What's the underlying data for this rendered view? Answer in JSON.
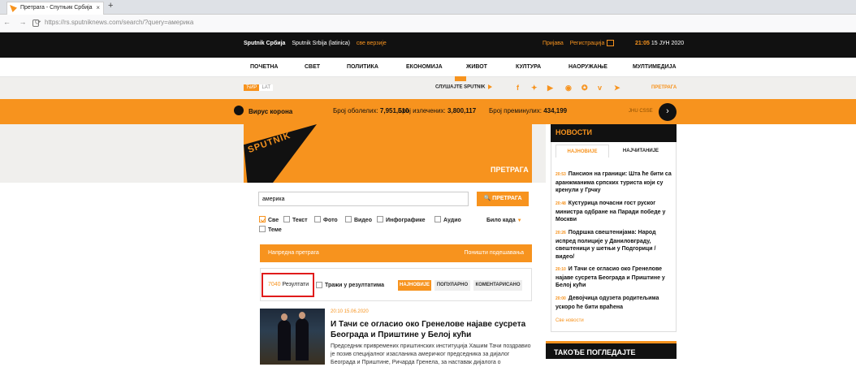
{
  "browser": {
    "tab_title": "Претрага - Спутњик Србија",
    "tab_close": "×",
    "new_tab": "+",
    "nav_buttons": "← → ⟳",
    "url": "https://rs.sputniknews.com/search/?query=америка"
  },
  "topbar": {
    "edition_main": "Sputnik Србија",
    "edition_latin": "Sputnik Srbija (latinica)",
    "all_versions": "све верзије",
    "login": "Пријава",
    "register": "Регистрација",
    "time": "21:05",
    "date": "15 ЈУН 2020"
  },
  "menu": [
    "ПОЧЕТНА",
    "СВЕТ",
    "ПОЛИТИКА",
    "ЕКОНОМИЈА",
    "ЖИВОТ",
    "КУЛТУРА",
    "НАОРУЖАЊЕ",
    "МУЛТИМЕДИЈА"
  ],
  "subbar": {
    "lang_cyr": "ЋИР",
    "lang_lat": "LAT",
    "listen": "СЛУШАЈТЕ SPUTNIK",
    "social_icons": [
      "facebook-icon",
      "twitter-icon",
      "youtube-icon",
      "rss-icon",
      "odnoklassniki-icon",
      "vk-icon",
      "telegram-icon"
    ],
    "social_glyphs": [
      "f",
      "✦",
      "▶",
      "◉",
      "✪",
      "ᴠ",
      "➤"
    ],
    "search_link": "ПРЕТРАГА"
  },
  "covid": {
    "title": "Вирус корона",
    "cases_label": "Број оболелих:",
    "cases": "7,951,610",
    "recovered_label": "Број излечених:",
    "recovered": "3,800,117",
    "deaths_label": "Број преминулих:",
    "deaths": "434,199",
    "source": "JHU CSSE",
    "arrow": "›"
  },
  "hero": {
    "logo": "SPUTNIK",
    "title": "ПРЕТРАГА"
  },
  "search": {
    "query": "америка",
    "button": "ПРЕТРАГА",
    "button_icon": "🔍",
    "filters": [
      {
        "label": "Све",
        "checked": true
      },
      {
        "label": "Текст",
        "checked": false
      },
      {
        "label": "Фото",
        "checked": false
      },
      {
        "label": "Видео",
        "checked": false
      },
      {
        "label": "Инфографике",
        "checked": false
      },
      {
        "label": "Аудио",
        "checked": false
      },
      {
        "label": "Теме",
        "checked": false
      }
    ],
    "period": "Било када",
    "period_caret": "▼",
    "advanced": "Напредна претрага",
    "reset": "Поништи подешавања"
  },
  "results": {
    "count": "7040",
    "label": "Резултати",
    "within": "Тражи у резултатима",
    "sort_newest": "НАЈНОВИЈЕ",
    "sort_popular": "ПОПУЛАРНО",
    "sort_commented": "КОМЕНТАРИСАНО"
  },
  "article": {
    "date": "20:10 15.06.2020",
    "title": "И Тачи се огласио око Гренелове најаве сусрета Београда и Приштине у Белој кући",
    "lead": "Председник привремених приштинских институција Хашим Тачи поздравио је позив специјалног изасланика америчког председника за дијалог Београда и Приштине, Ричарда Гренела, за наставак дијалога о"
  },
  "sidebar": {
    "title": "НОВОСТИ",
    "tab_latest": "НАЈНОВИЈЕ",
    "tab_read": "НАЈЧИТАНИЈЕ",
    "news": [
      {
        "time": "20:53",
        "text": "Пансион на граници: Шта ће бити са аранжманима српских туриста који су кренули у Грчку"
      },
      {
        "time": "20:48",
        "text": "Кустурица почасни гост руског министра одбране на Паради победе у Москви"
      },
      {
        "time": "20:26",
        "text": "Подршка свештенијама: Народ испред полиције у Даниловграду, свештеници у шетњи у Подгорици /видео/"
      },
      {
        "time": "20:10",
        "text": "И Тачи се огласио око Гренелове најаве сусрета Београда и Приштине у Белој кући"
      },
      {
        "time": "20:00",
        "text": "Девојчица одузета родитељима ускоро ће бити враћена"
      }
    ],
    "more": "Све новости",
    "also_title": "ТАКОЂЕ ПОГЛЕДАЈТЕ"
  }
}
